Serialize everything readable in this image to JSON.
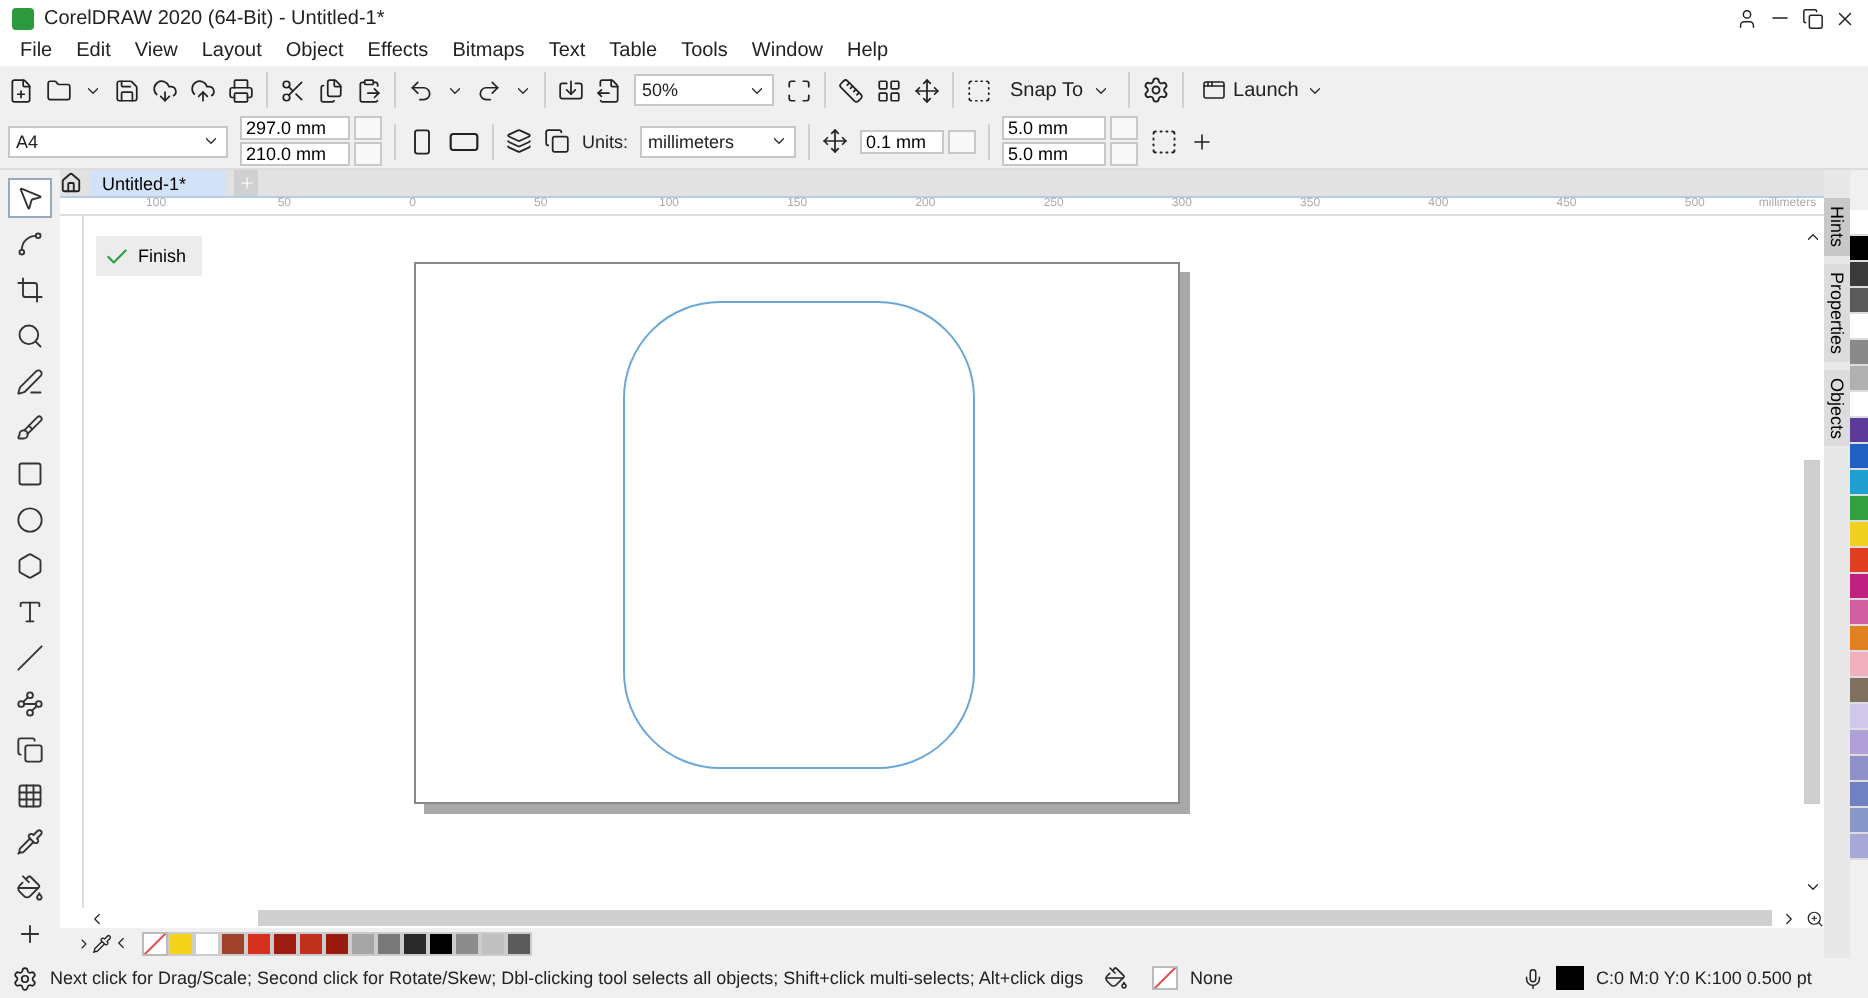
{
  "window": {
    "title": "CorelDRAW 2020 (64-Bit) - Untitled-1*"
  },
  "menu": [
    {
      "label": "File"
    },
    {
      "label": "Edit"
    },
    {
      "label": "View"
    },
    {
      "label": "Layout"
    },
    {
      "label": "Object"
    },
    {
      "label": "Effects"
    },
    {
      "label": "Bitmaps"
    },
    {
      "label": "Text"
    },
    {
      "label": "Table"
    },
    {
      "label": "Tools"
    },
    {
      "label": "Window"
    },
    {
      "label": "Help"
    }
  ],
  "toolbar": {
    "zoom": "50%",
    "snap": {
      "label": "Snap To"
    },
    "launch": "Launch"
  },
  "property_bar": {
    "page_size": "A4",
    "width": "297.0 mm",
    "height": "210.0 mm",
    "units_label": "Units:",
    "units": "millimeters",
    "nudge": "0.1 mm",
    "duplicate_x": "5.0 mm",
    "duplicate_y": "5.0 mm"
  },
  "toolbox": [
    {
      "kind": "pick",
      "selected": true
    },
    {
      "kind": "shape",
      "selected": false
    },
    {
      "kind": "crop",
      "selected": false
    },
    {
      "kind": "zoom",
      "selected": false
    },
    {
      "kind": "freehand",
      "selected": false
    },
    {
      "kind": "artistic",
      "selected": false
    },
    {
      "kind": "rectangle",
      "selected": false
    },
    {
      "kind": "ellipse",
      "selected": false
    },
    {
      "kind": "polygon",
      "selected": false
    },
    {
      "kind": "text",
      "selected": false
    },
    {
      "kind": "dimension",
      "selected": false
    },
    {
      "kind": "connector",
      "selected": false
    },
    {
      "kind": "shadow",
      "selected": false
    },
    {
      "kind": "transparency",
      "selected": false
    },
    {
      "kind": "eyedropper",
      "selected": false
    },
    {
      "kind": "fill",
      "selected": false
    },
    {
      "kind": "add",
      "selected": false
    }
  ],
  "document_tabs": [
    {
      "label": "Untitled-1*",
      "selected": true
    }
  ],
  "ruler": {
    "labels": [
      "100",
      "50",
      "0",
      "50",
      "100",
      "150",
      "200",
      "250",
      "300",
      "350",
      "400",
      "450",
      "500"
    ],
    "unit": "millimeters"
  },
  "canvas": {
    "finish_button": "Finish"
  },
  "dockers": [
    {
      "label": "Hints",
      "selected": true
    },
    {
      "label": "Properties",
      "selected": false
    },
    {
      "label": "Objects",
      "selected": false
    }
  ],
  "document_palette": [
    {
      "color": "#f5d31a"
    },
    {
      "color": "#ffffff"
    },
    {
      "color": "#a0432a"
    },
    {
      "color": "#d8301e"
    },
    {
      "color": "#a01c10"
    },
    {
      "color": "#c0301c"
    },
    {
      "color": "#9a1a10"
    },
    {
      "color": "#a6a6a6"
    },
    {
      "color": "#787878"
    },
    {
      "color": "#2a2a2a"
    },
    {
      "color": "#000000"
    },
    {
      "color": "#8c8c8c"
    },
    {
      "color": "#c0c0c0"
    },
    {
      "color": "#5a5a5a"
    }
  ],
  "color_palette": [
    {
      "color": "#ffffff"
    },
    {
      "color": "#000000"
    },
    {
      "color": "#3a3a3a"
    },
    {
      "color": "#5a5a5a"
    },
    {
      "color": "#ffffff"
    },
    {
      "color": "#8a8a8a"
    },
    {
      "color": "#b0b0b0"
    },
    {
      "color": "#ffffff"
    },
    {
      "color": "#5b3a9a"
    },
    {
      "color": "#2060c0"
    },
    {
      "color": "#20a0d0"
    },
    {
      "color": "#30a040"
    },
    {
      "color": "#f0d020"
    },
    {
      "color": "#e04020"
    },
    {
      "color": "#c02080"
    },
    {
      "color": "#d060a0"
    },
    {
      "color": "#e08020"
    },
    {
      "color": "#f0b0c0"
    },
    {
      "color": "#807060"
    },
    {
      "color": "#d0c8e8"
    },
    {
      "color": "#b0a0d8"
    },
    {
      "color": "#9090c8"
    },
    {
      "color": "#7080c0"
    },
    {
      "color": "#8898c8"
    },
    {
      "color": "#a8a8d8"
    }
  ],
  "status_bar": {
    "hint": "Next click for Drag/Scale; Second click for Rotate/Skew; Dbl-clicking tool selects all objects; Shift+click multi-selects; Alt+click digs",
    "fill": "None",
    "outline": "C:0 M:0 Y:0 K:100  0.500 pt"
  }
}
